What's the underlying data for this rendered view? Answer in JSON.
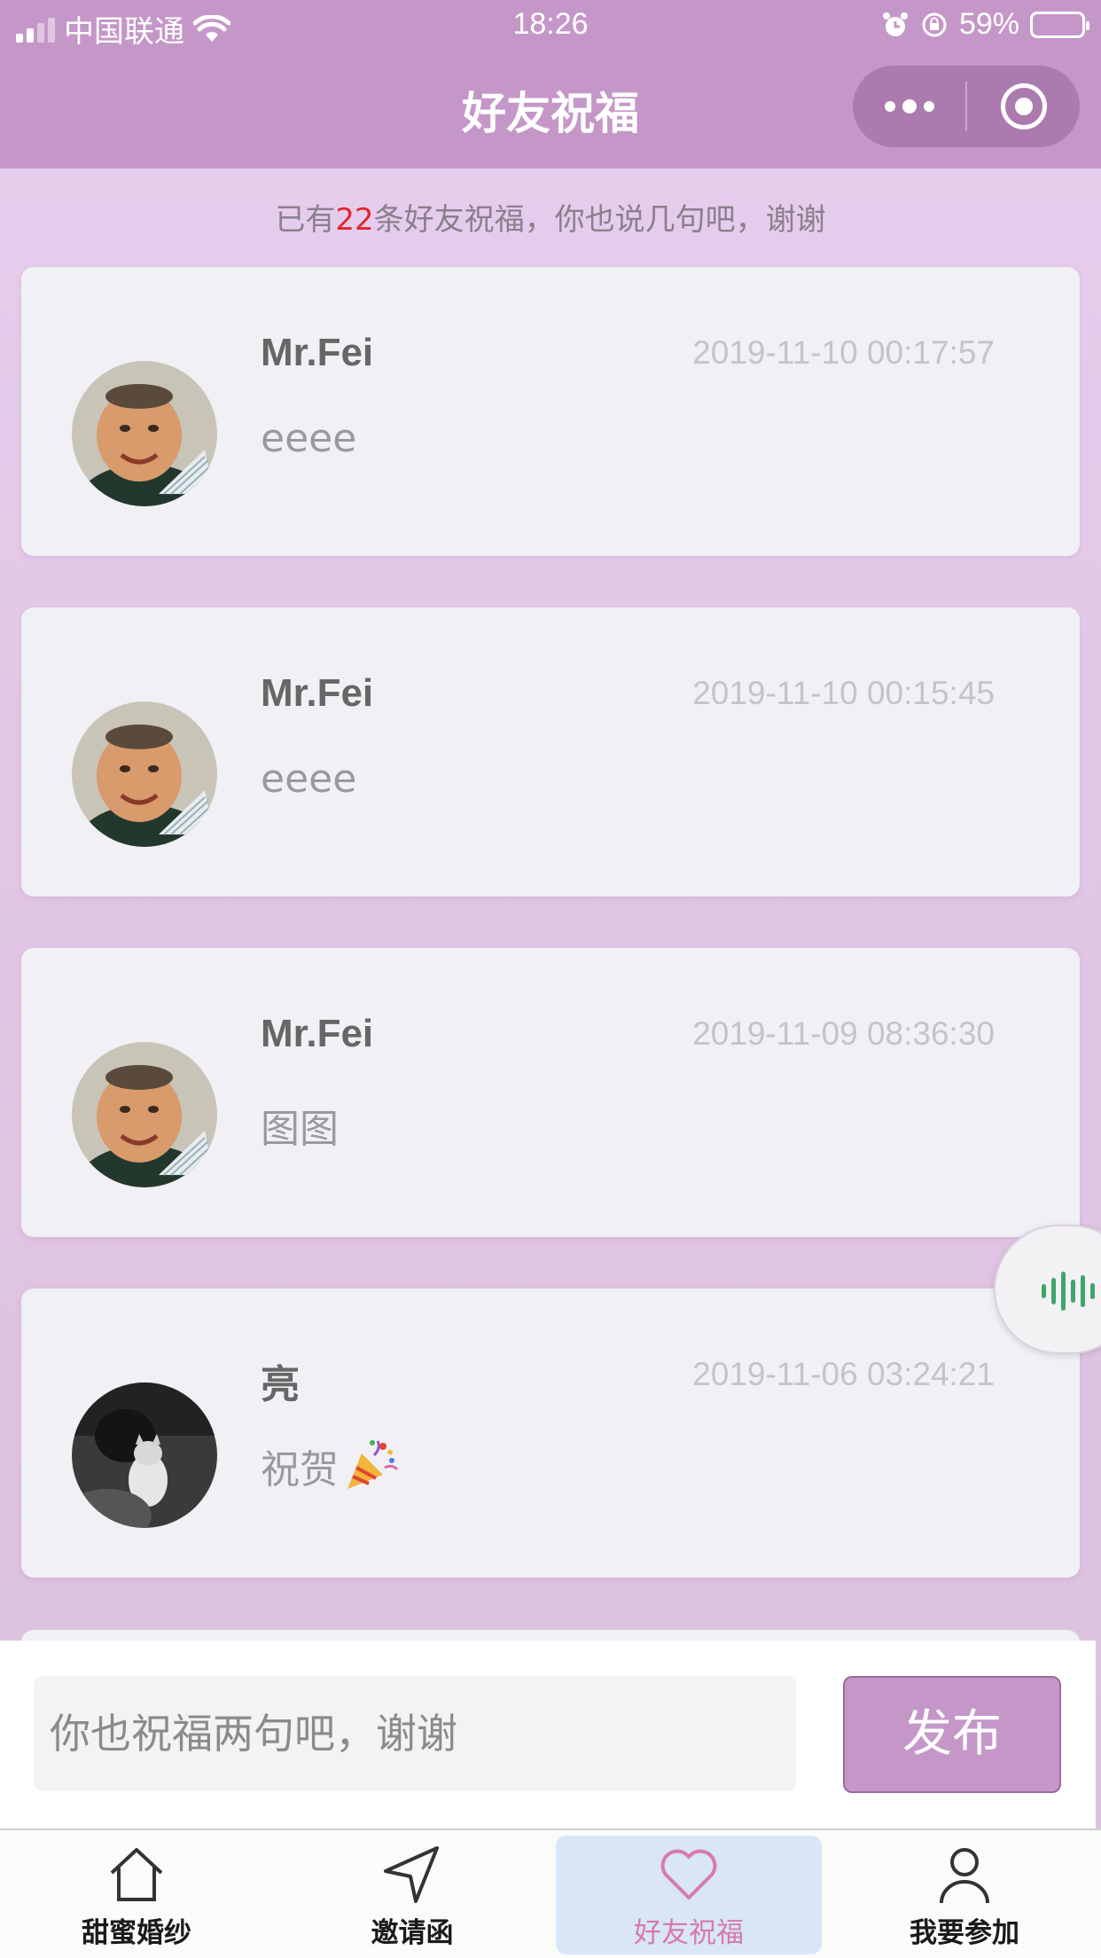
{
  "status_bar": {
    "carrier": "中国联通",
    "time": "18:26",
    "battery": "59%"
  },
  "nav": {
    "title": "好友祝福"
  },
  "summary": {
    "prefix": "已有",
    "count": "22",
    "suffix": "条好友祝福，你也说几句吧，谢谢"
  },
  "messages": [
    {
      "name": "Mr.Fei",
      "time": "2019-11-10 00:17:57",
      "text": "eeee"
    },
    {
      "name": "Mr.Fei",
      "time": "2019-11-10 00:15:45",
      "text": "eeee"
    },
    {
      "name": "Mr.Fei",
      "time": "2019-11-09 08:36:30",
      "text": "图图"
    },
    {
      "name": "亮",
      "time": "2019-11-06 03:24:21",
      "text": "祝贺",
      "emoji_icon": "party-popper-icon"
    }
  ],
  "composer": {
    "placeholder": "你也祝福两句吧，谢谢",
    "publish_label": "发布"
  },
  "tabs": [
    {
      "label": "甜蜜婚纱",
      "icon": "home-icon"
    },
    {
      "label": "邀请函",
      "icon": "send-icon"
    },
    {
      "label": "好友祝福",
      "icon": "heart-icon",
      "active": true
    },
    {
      "label": "我要参加",
      "icon": "person-icon"
    }
  ],
  "colors": {
    "accent": "#c597c8",
    "count_red": "#e0262b",
    "active_tab_text": "#d77aae",
    "active_tab_bg": "#d8e6f7",
    "voice_green": "#3fa66a"
  }
}
